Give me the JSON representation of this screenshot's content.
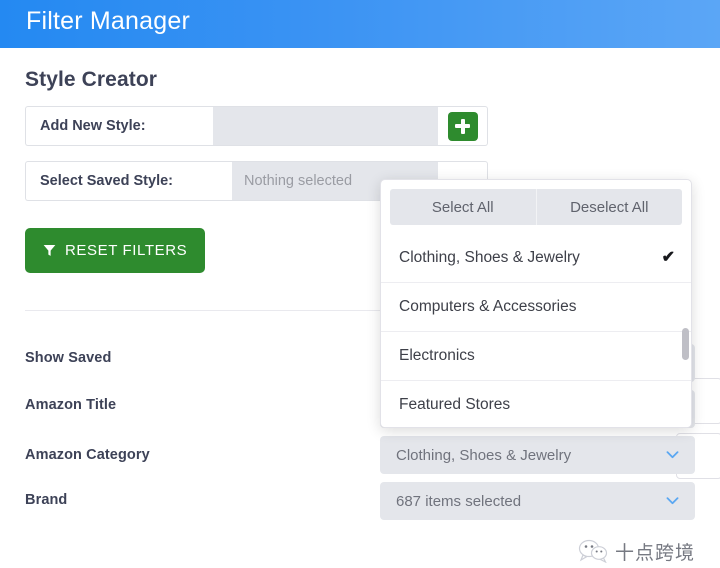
{
  "header": {
    "title": "Filter Manager",
    "gradient_from": "#2489f2",
    "gradient_to": "#5ba6f6"
  },
  "page": {
    "section_title": "Style Creator"
  },
  "style_creator": {
    "add_new_style": {
      "label": "Add New Style:",
      "value": "",
      "placeholder": "",
      "add_button_icon": "plus-icon"
    },
    "select_saved_style": {
      "label": "Select Saved Style:",
      "value": "Nothing selected",
      "toggle_icon": "caret-down-icon"
    },
    "reset_filters_button": {
      "label": "RESET FILTERS",
      "icon": "funnel-icon",
      "color": "#2e8b2e"
    }
  },
  "filters": {
    "rows": [
      {
        "label": "Show Saved",
        "value": ""
      },
      {
        "label": "Amazon Title",
        "value": ""
      },
      {
        "label": "Amazon Category",
        "value": "Clothing, Shoes & Jewelry"
      },
      {
        "label": "Brand",
        "value": "687 items selected"
      }
    ]
  },
  "category_popup": {
    "select_all_label": "Select All",
    "deselect_all_label": "Deselect All",
    "items": [
      {
        "label": "Clothing, Shoes & Jewelry",
        "checked": true,
        "check_glyph": "✔"
      },
      {
        "label": "Computers & Accessories",
        "checked": false,
        "check_glyph": ""
      },
      {
        "label": "Electronics",
        "checked": false,
        "check_glyph": ""
      },
      {
        "label": "Featured Stores",
        "checked": false,
        "check_glyph": ""
      }
    ]
  },
  "watermark": {
    "text": "十点跨境",
    "icon": "wechat-icon"
  }
}
